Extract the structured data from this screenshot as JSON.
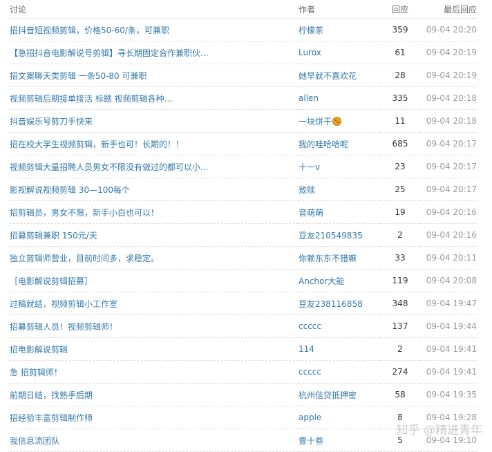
{
  "headers": {
    "title": "讨论",
    "author": "作者",
    "replies": "回应",
    "last_reply": "最后回应"
  },
  "rows": [
    {
      "title": "招抖音短视频剪辑，价格50-60/条，可兼职",
      "author": "柠檬茶",
      "replies": "359",
      "time": "09-04 20:20"
    },
    {
      "title": "【急招抖音电影解说号剪辑】寻长期固定合作兼职伙...",
      "author": "Lurox",
      "replies": "61",
      "time": "09-04 20:19"
    },
    {
      "title": "招文案聊天类剪辑 一条50-80 可兼职",
      "author": "她早就不喜欢花",
      "replies": "28",
      "time": "09-04 20:19"
    },
    {
      "title": "视频剪辑后期接单接活 标题 视频剪辑各种...",
      "author": "allen",
      "replies": "335",
      "time": "09-04 20:18"
    },
    {
      "title": "抖音娱乐号剪刀手快来",
      "author": "一块饼干",
      "author_icon": "cookie-emoji-icon",
      "replies": "11",
      "time": "09-04 20:18"
    },
    {
      "title": "招在校大学生视频剪辑，新手也可！长期的！！",
      "author": "我的哇哈哈呢",
      "replies": "685",
      "time": "09-04 20:17"
    },
    {
      "title": "视频剪辑大量招聘人员男女不限没有做过的都可以小...",
      "author": "十一v",
      "replies": "23",
      "time": "09-04 20:17"
    },
    {
      "title": "影视解说视频剪辑 30—100每个",
      "author": "敖赎",
      "replies": "25",
      "time": "09-04 20:17"
    },
    {
      "title": "招剪辑员，男女不限，新手小白也可以！",
      "author": "音萌萌",
      "replies": "19",
      "time": "09-04 20:16"
    },
    {
      "title": "招募剪辑兼职 150元/天",
      "author": "豆友210549835",
      "replies": "2",
      "time": "09-04 20:16"
    },
    {
      "title": "独立剪辑师营业，目前时间多，求稳定。",
      "author": "你赖东东不错嘛",
      "replies": "33",
      "time": "09-04 20:11"
    },
    {
      "title": "［电影解说剪辑招募］",
      "author": "Anchor大能",
      "replies": "119",
      "time": "09-04 20:08"
    },
    {
      "title": "过稿就结，视频剪辑小工作室",
      "author": "豆友238116858",
      "replies": "348",
      "time": "09-04 19:47"
    },
    {
      "title": "招募剪辑人员！视频剪辑师！",
      "author": "ccccc",
      "replies": "137",
      "time": "09-04 19:44"
    },
    {
      "title": "招电影解说剪辑",
      "author": "114",
      "replies": "2",
      "time": "09-04 19:41"
    },
    {
      "title": "急 招剪辑师！",
      "author": "ccccc",
      "replies": "274",
      "time": "09-04 19:41"
    },
    {
      "title": "前期日结，找熟手后期",
      "author": "杭州信贷抵押密",
      "replies": "58",
      "time": "09-04 19:35"
    },
    {
      "title": "招经验丰富剪辑制作师",
      "author": "apple",
      "replies": "8",
      "time": "09-04 19:28"
    },
    {
      "title": "我信息流团队",
      "author": "壹十叁",
      "replies": "5",
      "time": "09-04 19:10"
    }
  ],
  "watermark": "知乎 @精进青年",
  "colors": {
    "link": "#3377aa",
    "header_text": "#666666",
    "time_text": "#999999",
    "reply_count": "#333333"
  }
}
